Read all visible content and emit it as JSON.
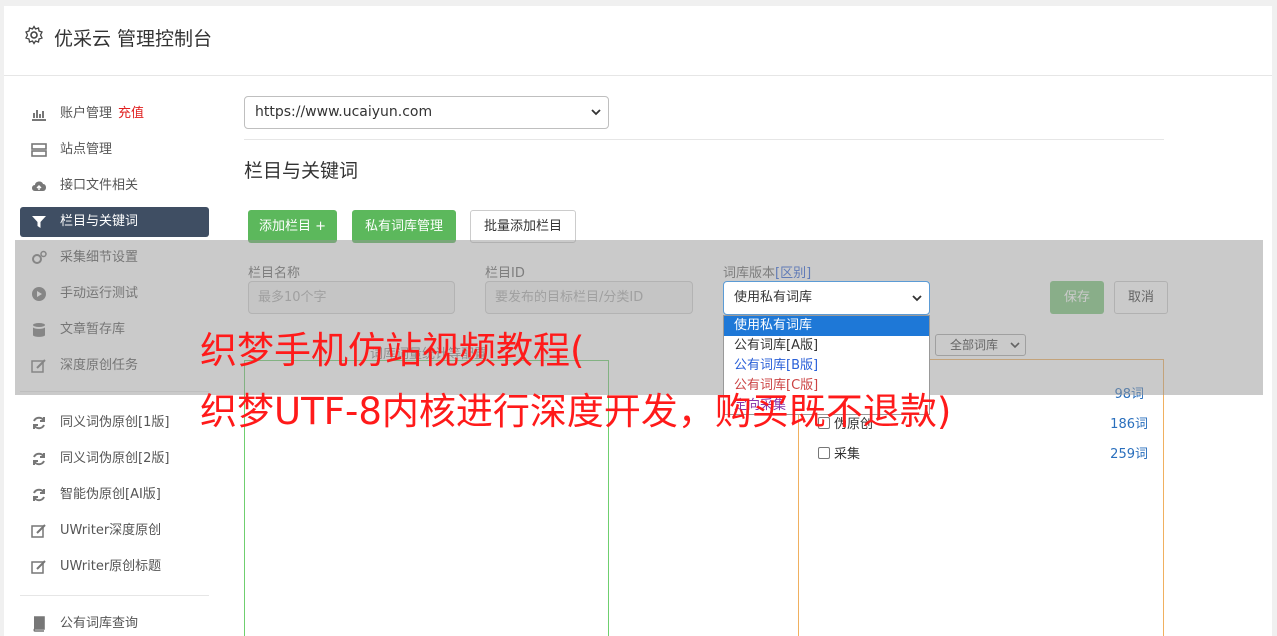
{
  "header": {
    "title": "优采云 管理控制台"
  },
  "sidebar": {
    "items": [
      {
        "label": "账户管理",
        "badge": "充值",
        "icon": "bar-chart-icon"
      },
      {
        "label": "站点管理",
        "icon": "server-icon"
      },
      {
        "label": "接口文件相关",
        "icon": "cloud-upload-icon"
      },
      {
        "label": "栏目与关键词",
        "icon": "filter-icon"
      },
      {
        "label": "采集细节设置",
        "icon": "gears-icon"
      },
      {
        "label": "手动运行测试",
        "icon": "play-circle-icon"
      },
      {
        "label": "文章暂存库",
        "icon": "database-icon"
      },
      {
        "label": "深度原创任务",
        "icon": "edit-icon"
      },
      {
        "label": "同义词伪原创[1版]",
        "icon": "refresh-icon"
      },
      {
        "label": "同义词伪原创[2版]",
        "icon": "refresh-icon"
      },
      {
        "label": "智能伪原创[AI版]",
        "icon": "refresh-icon"
      },
      {
        "label": "UWriter深度原创",
        "icon": "edit-icon"
      },
      {
        "label": "UWriter原创标题",
        "icon": "edit-icon"
      },
      {
        "label": "公有词库查询",
        "icon": "book-icon"
      }
    ]
  },
  "main": {
    "site_select": "https://www.ucaiyun.com",
    "section_title": "栏目与关键词",
    "buttons": {
      "add_column": "添加栏目 +",
      "private_lib": "私有词库管理",
      "batch_add": "批量添加栏目",
      "save": "保存",
      "cancel": "取消"
    },
    "form": {
      "name_label": "栏目名称",
      "name_placeholder": "最多10个字",
      "id_label": "栏目ID",
      "id_placeholder": "要发布的目标栏目/分类ID",
      "version_label": "词库版本",
      "version_link": "[区别]",
      "version_value": "使用私有词库",
      "version_options": [
        "使用私有词库",
        "公有词库[A版]",
        "公有词库[B版]",
        "公有词库[C版]",
        "定向采集"
      ]
    },
    "partial_label": "词库词量统计等配置",
    "all_lib": "全部词库",
    "lib_rows": [
      {
        "label": "",
        "count": "98词"
      },
      {
        "label": "伪原创",
        "count": "186词"
      },
      {
        "label": "采集",
        "count": "259词"
      }
    ]
  },
  "watermark": {
    "line1": "织梦手机仿站视频教程(",
    "line2": "织梦UTF-8内核进行深度开发，购买既不退款)"
  },
  "colors": {
    "active_nav": "#3f4e63",
    "green": "#5cb85c",
    "watermark": "#ff1a1a",
    "dropdown_selected": "#1e78d7"
  }
}
